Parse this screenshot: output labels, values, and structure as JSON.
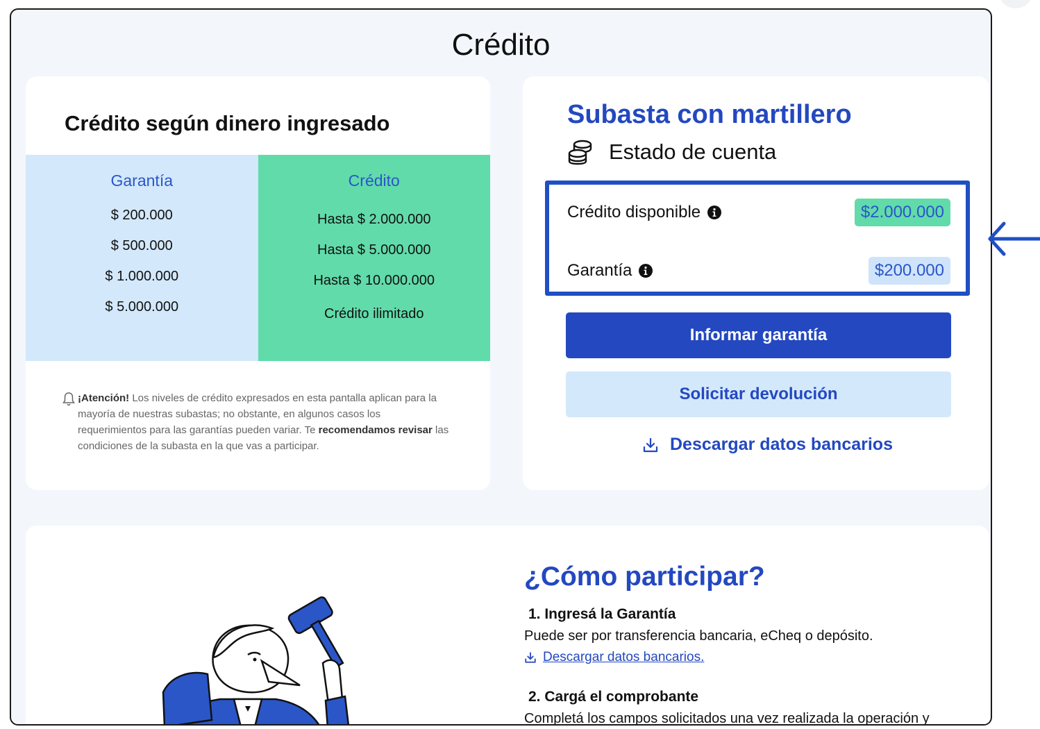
{
  "page": {
    "title": "Crédito"
  },
  "credit_table": {
    "title": "Crédito según dinero ingresado",
    "garantia_header": "Garantía",
    "credito_header": "Crédito",
    "garantia_values": [
      "$ 200.000",
      "$ 500.000",
      "$ 1.000.000",
      "$ 5.000.000"
    ],
    "credito_values": [
      "Hasta $ 2.000.000",
      "Hasta $ 5.000.000",
      "Hasta $ 10.000.000",
      "Crédito ilimitado"
    ]
  },
  "attention": {
    "label": "¡Atención!",
    "text1": " Los niveles de crédito expresados en esta pantalla aplican para la mayoría de nuestras subastas; no obstante, en algunos casos los requerimientos para las garantías pueden variar. Te ",
    "bold": "recomendamos revisar",
    "text2": " las condiciones de la subasta en la que vas a participar."
  },
  "account": {
    "title_regular": "Subasta",
    "title_bold": "con martillero",
    "subtitle": "Estado de cuenta",
    "credito_disponible_label": "Crédito disponible",
    "credito_disponible_value": "$2.000.000",
    "garantia_label": "Garantía",
    "garantia_value": "$200.000",
    "informar_button": "Informar garantía",
    "solicitar_button": "Solicitar devolución",
    "descargar_link": "Descargar datos bancarios"
  },
  "how_to": {
    "title": "¿Cómo participar?",
    "steps": [
      {
        "title": "1.  Ingresá la Garantía",
        "text": "Puede ser por transferencia bancaria, eCheq o depósito.",
        "link": "Descargar datos bancarios."
      },
      {
        "title": "2.  Cargá el comprobante",
        "text": "Completá los campos solicitados una vez realizada la operación y"
      }
    ]
  },
  "colors": {
    "primary_blue": "#2348c0",
    "light_blue": "#d3e8fb",
    "green": "#61dbaa",
    "page_bg": "#f3f6fa"
  },
  "icons": [
    "coins-icon",
    "info-icon",
    "download-icon",
    "bell-icon",
    "arrow-left-icon"
  ]
}
